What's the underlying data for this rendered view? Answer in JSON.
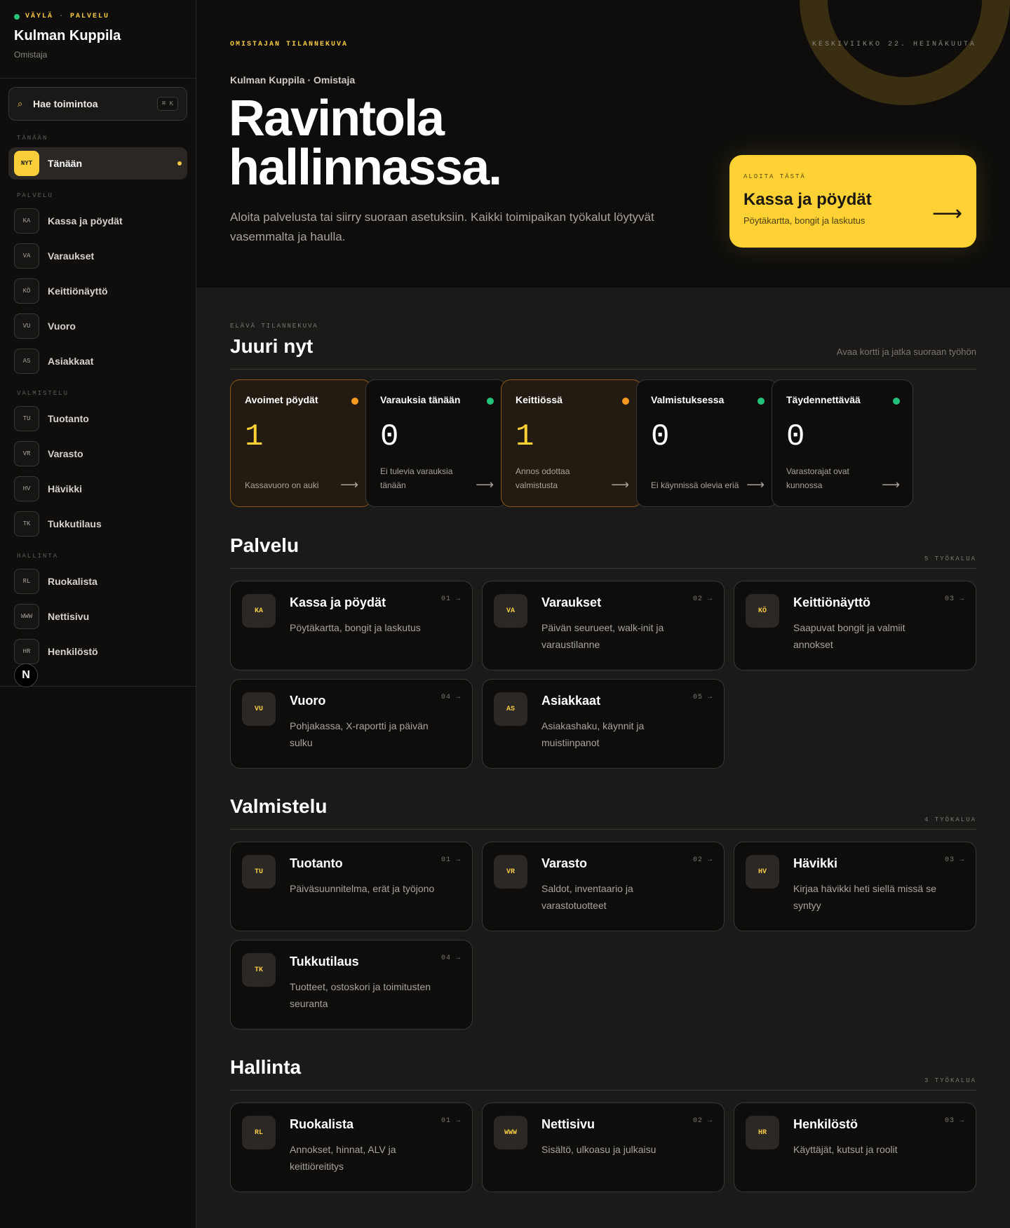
{
  "brand": {
    "channel": "VÄYLÄ",
    "area": "PALVELU",
    "name": "Kulman Kuppila",
    "role": "Omistaja"
  },
  "search": {
    "label": "Hae toimintoa",
    "shortcut": "⌘ K"
  },
  "sidebar": {
    "sections": [
      {
        "title": "TÄNÄÄN",
        "items": [
          {
            "badge": "NYT",
            "label": "Tänään",
            "active": true
          }
        ]
      },
      {
        "title": "PALVELU",
        "items": [
          {
            "badge": "KA",
            "label": "Kassa ja pöydät"
          },
          {
            "badge": "VA",
            "label": "Varaukset"
          },
          {
            "badge": "KÖ",
            "label": "Keittiönäyttö"
          },
          {
            "badge": "VU",
            "label": "Vuoro"
          },
          {
            "badge": "AS",
            "label": "Asiakkaat"
          }
        ]
      },
      {
        "title": "VALMISTELU",
        "items": [
          {
            "badge": "TU",
            "label": "Tuotanto"
          },
          {
            "badge": "VR",
            "label": "Varasto"
          },
          {
            "badge": "HV",
            "label": "Hävikki"
          },
          {
            "badge": "TK",
            "label": "Tukkutilaus"
          }
        ]
      },
      {
        "title": "HALLINTA",
        "items": [
          {
            "badge": "RL",
            "label": "Ruokalista"
          },
          {
            "badge": "WWW",
            "label": "Nettisivu"
          },
          {
            "badge": "HR",
            "label": "Henkilöstö"
          }
        ]
      }
    ],
    "n_badge": "N"
  },
  "hero": {
    "eyebrow": "OMISTAJAN TILANNEKUVA",
    "date": "KESKIVIIKKO 22. HEINÄKUUTA",
    "subtitle": "Kulman Kuppila · Omistaja",
    "title_line1": "Ravintola",
    "title_line2": "hallinnassa.",
    "description": "Aloita palvelusta tai siirry suoraan asetuksiin. Kaikki toimipaikan työkalut löytyvät vasemmalta ja haulla.",
    "cta": {
      "eyebrow": "ALOITA TÄSTÄ",
      "title": "Kassa ja pöydät",
      "description": "Pöytäkartta, bongit ja laskutus",
      "arrow": "⟶"
    }
  },
  "live": {
    "eyebrow": "ELÄVÄ TILANNEKUVA",
    "title": "Juuri nyt",
    "hint": "Avaa kortti ja jatka suoraan työhön",
    "cards": [
      {
        "label": "Avoimet pöydät",
        "value": "1",
        "description": "Kassavuoro on auki",
        "status": "warn",
        "dot_color": "#f59a1f"
      },
      {
        "label": "Varauksia tänään",
        "value": "0",
        "description": "Ei tulevia varauksia tänään",
        "status": "ok",
        "dot_color": "#22c27a"
      },
      {
        "label": "Keittiössä",
        "value": "1",
        "description": "Annos odottaa valmistusta",
        "status": "warn",
        "dot_color": "#f59a1f"
      },
      {
        "label": "Valmistuksessa",
        "value": "0",
        "description": "Ei käynnissä olevia eriä",
        "status": "ok",
        "dot_color": "#22c27a"
      },
      {
        "label": "Täydennettävää",
        "value": "0",
        "description": "Varastorajat ovat kunnossa",
        "status": "ok",
        "dot_color": "#22c27a"
      }
    ],
    "arrow": "⟶"
  },
  "sections": [
    {
      "title": "Palvelu",
      "count": "5 TYÖKALUA",
      "tools": [
        {
          "badge": "KA",
          "title": "Kassa ja pöydät",
          "description": "Pöytäkartta, bongit ja laskutus",
          "num": "01 →"
        },
        {
          "badge": "VA",
          "title": "Varaukset",
          "description": "Päivän seurueet, walk-init ja varaustilanne",
          "num": "02 →"
        },
        {
          "badge": "KÖ",
          "title": "Keittiönäyttö",
          "description": "Saapuvat bongit ja valmiit annokset",
          "num": "03 →"
        },
        {
          "badge": "VU",
          "title": "Vuoro",
          "description": "Pohjakassa, X-raportti ja päivän sulku",
          "num": "04 →"
        },
        {
          "badge": "AS",
          "title": "Asiakkaat",
          "description": "Asiakashaku, käynnit ja muistiinpanot",
          "num": "05 →"
        }
      ]
    },
    {
      "title": "Valmistelu",
      "count": "4 TYÖKALUA",
      "tools": [
        {
          "badge": "TU",
          "title": "Tuotanto",
          "description": "Päiväsuunnitelma, erät ja työjono",
          "num": "01 →"
        },
        {
          "badge": "VR",
          "title": "Varasto",
          "description": "Saldot, inventaario ja varastotuotteet",
          "num": "02 →"
        },
        {
          "badge": "HV",
          "title": "Hävikki",
          "description": "Kirjaa hävikki heti siellä missä se syntyy",
          "num": "03 →"
        },
        {
          "badge": "TK",
          "title": "Tukkutilaus",
          "description": "Tuotteet, ostoskori ja toimitusten seuranta",
          "num": "04 →"
        }
      ]
    },
    {
      "title": "Hallinta",
      "count": "3 TYÖKALUA",
      "tools": [
        {
          "badge": "RL",
          "title": "Ruokalista",
          "description": "Annokset, hinnat, ALV ja keittiöreititys",
          "num": "01 →"
        },
        {
          "badge": "WWW",
          "title": "Nettisivu",
          "description": "Sisältö, ulkoasu ja julkaisu",
          "num": "02 →"
        },
        {
          "badge": "HR",
          "title": "Henkilöstö",
          "description": "Käyttäjät, kutsut ja roolit",
          "num": "03 →"
        }
      ]
    }
  ]
}
